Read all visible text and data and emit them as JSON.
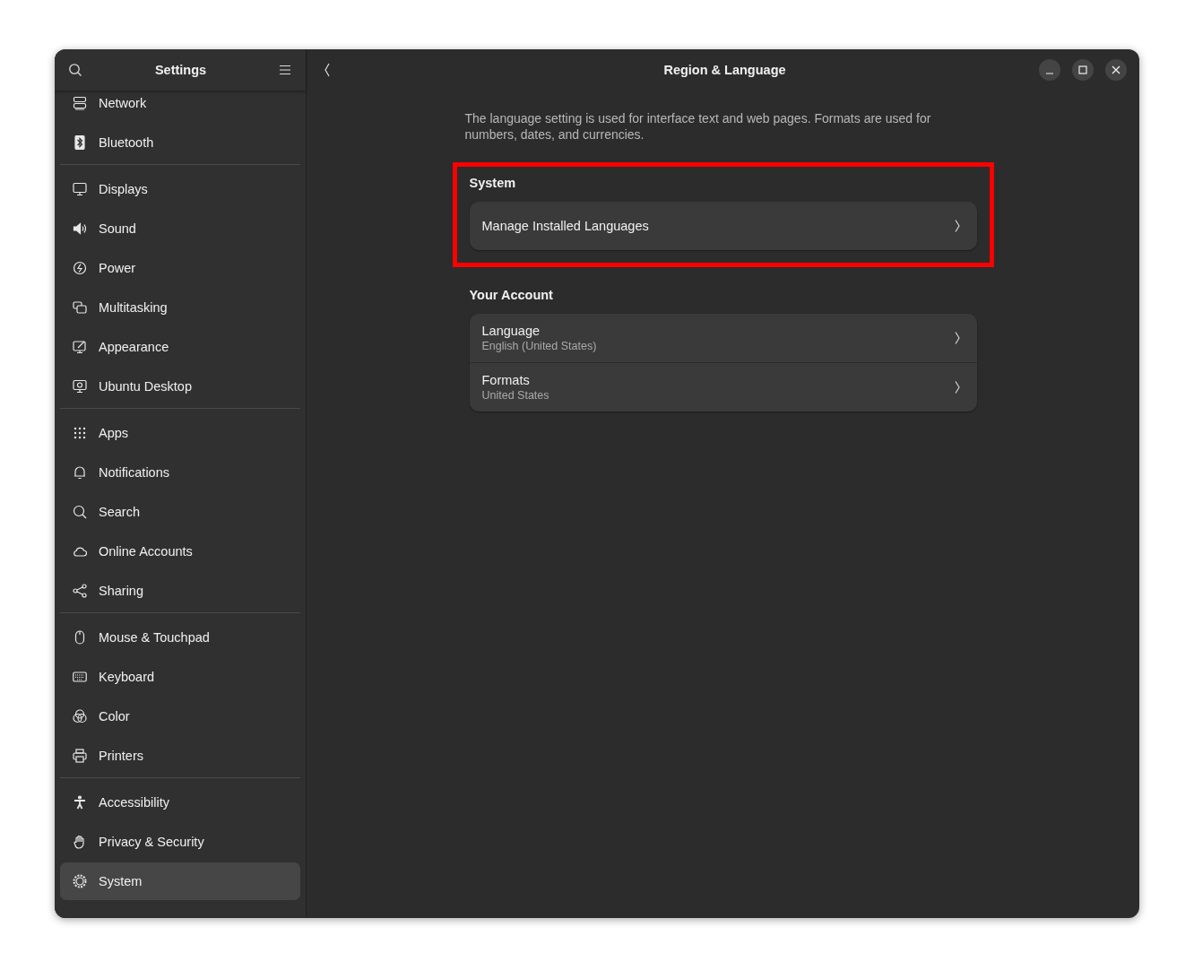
{
  "sidebar": {
    "title": "Settings",
    "groups": [
      {
        "items": [
          {
            "label": "Network",
            "kind": "network",
            "selected": false
          },
          {
            "label": "Bluetooth",
            "kind": "bluetooth",
            "selected": false
          }
        ]
      },
      {
        "items": [
          {
            "label": "Displays",
            "kind": "display",
            "selected": false
          },
          {
            "label": "Sound",
            "kind": "sound",
            "selected": false
          },
          {
            "label": "Power",
            "kind": "power",
            "selected": false
          },
          {
            "label": "Multitasking",
            "kind": "multitasking",
            "selected": false
          },
          {
            "label": "Appearance",
            "kind": "appearance",
            "selected": false
          },
          {
            "label": "Ubuntu Desktop",
            "kind": "desktop",
            "selected": false
          }
        ]
      },
      {
        "items": [
          {
            "label": "Apps",
            "kind": "apps",
            "selected": false
          },
          {
            "label": "Notifications",
            "kind": "bell",
            "selected": false
          },
          {
            "label": "Search",
            "kind": "search",
            "selected": false
          },
          {
            "label": "Online Accounts",
            "kind": "cloud",
            "selected": false
          },
          {
            "label": "Sharing",
            "kind": "share",
            "selected": false
          }
        ]
      },
      {
        "items": [
          {
            "label": "Mouse & Touchpad",
            "kind": "mouse",
            "selected": false
          },
          {
            "label": "Keyboard",
            "kind": "keyboard",
            "selected": false
          },
          {
            "label": "Color",
            "kind": "color",
            "selected": false
          },
          {
            "label": "Printers",
            "kind": "printer",
            "selected": false
          }
        ]
      },
      {
        "items": [
          {
            "label": "Accessibility",
            "kind": "accessibility",
            "selected": false
          },
          {
            "label": "Privacy & Security",
            "kind": "hand",
            "selected": false
          },
          {
            "label": "System",
            "kind": "gear",
            "selected": true
          }
        ]
      }
    ]
  },
  "page": {
    "title": "Region & Language",
    "description": "The language setting is used for interface text and web pages. Formats are used for numbers, dates, and currencies.",
    "sections": [
      {
        "heading": "System",
        "highlighted": true,
        "rows": [
          {
            "title": "Manage Installed Languages"
          }
        ]
      },
      {
        "heading": "Your Account",
        "highlighted": false,
        "rows": [
          {
            "title": "Language",
            "subtitle": "English (United States)"
          },
          {
            "title": "Formats",
            "subtitle": "United States"
          }
        ]
      }
    ]
  }
}
